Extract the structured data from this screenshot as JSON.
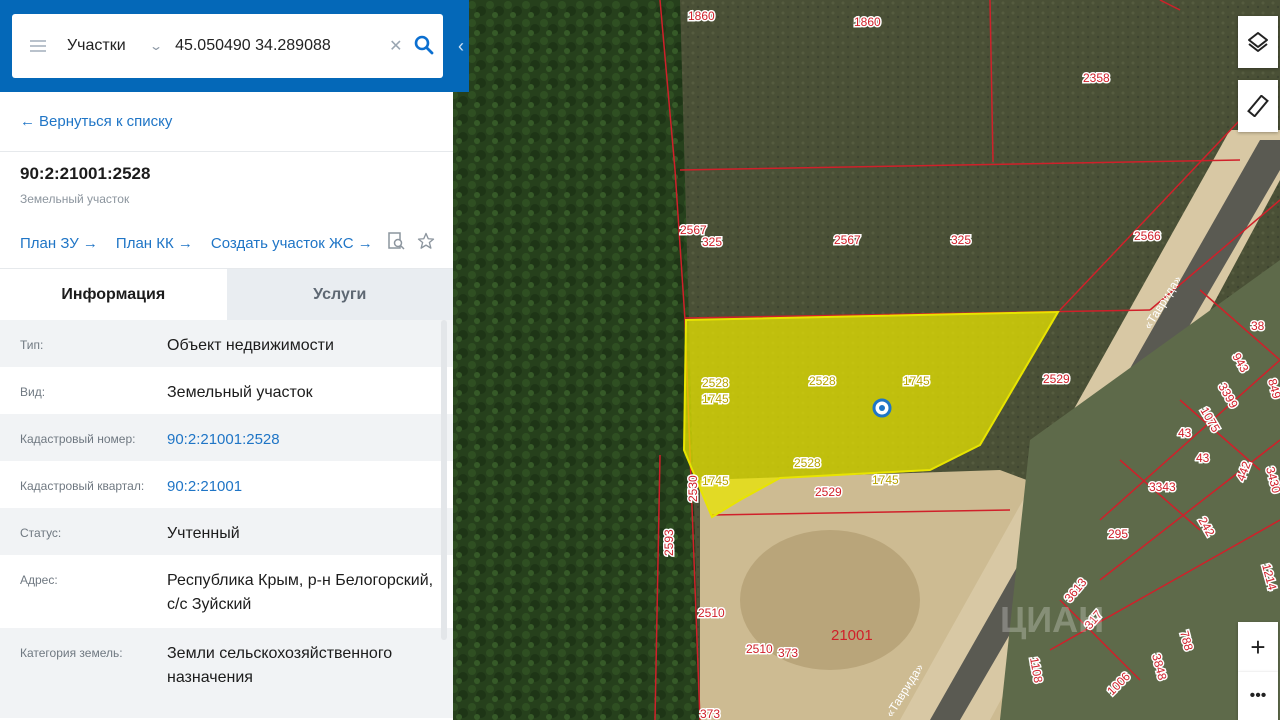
{
  "search": {
    "type_label": "Участки",
    "query": "45.050490 34.289088"
  },
  "back_link": "Вернуться к списку",
  "parcel": {
    "id": "90:2:21001:2528",
    "subtitle": "Земельный участок"
  },
  "links": [
    {
      "label": "План ЗУ"
    },
    {
      "label": "План КК"
    },
    {
      "label": "Создать участок ЖС"
    }
  ],
  "tabs": {
    "info": "Информация",
    "services": "Услуги"
  },
  "info_rows": [
    {
      "label": "Тип:",
      "value": "Объект недвижимости"
    },
    {
      "label": "Вид:",
      "value": "Земельный участок"
    },
    {
      "label": "Кадастровый номер:",
      "value": "90:2:21001:2528"
    },
    {
      "label": "Кадастровый квартал:",
      "value": "90:2:21001"
    },
    {
      "label": "Статус:",
      "value": "Учтенный"
    },
    {
      "label": "Адрес:",
      "value": "Республика Крым, р-н Белогорский, с/с Зуйский"
    },
    {
      "label": "Категория земель:",
      "value": "Земли сельскохозяйственного назначения"
    }
  ],
  "map": {
    "parcel_labels": [
      "1860",
      "1860",
      "2358",
      "2567",
      "325",
      "2567",
      "325",
      "2566",
      "2528",
      "1745",
      "2528",
      "1745",
      "2529",
      "2528",
      "1745",
      "1745",
      "2529",
      "2530",
      "2593",
      "2510",
      "2510",
      "373",
      "21001",
      "373",
      "38",
      "943",
      "3399",
      "1075",
      "43",
      "43",
      "3343",
      "295",
      "242",
      "442",
      "3613",
      "317",
      "1108",
      "1006",
      "3848",
      "788",
      "1214",
      "849",
      "3430"
    ],
    "road_label": "«Таврида»",
    "road_label_2": "«Таврида»",
    "watermark": "ЦИАН",
    "colors": {
      "parcel_border": "#d0202a",
      "selected_fill": "#e8e400",
      "panel_header": "#0468b8",
      "link": "#1f75c6"
    }
  },
  "controls": {
    "zoom_in": "+",
    "more": "•••"
  }
}
